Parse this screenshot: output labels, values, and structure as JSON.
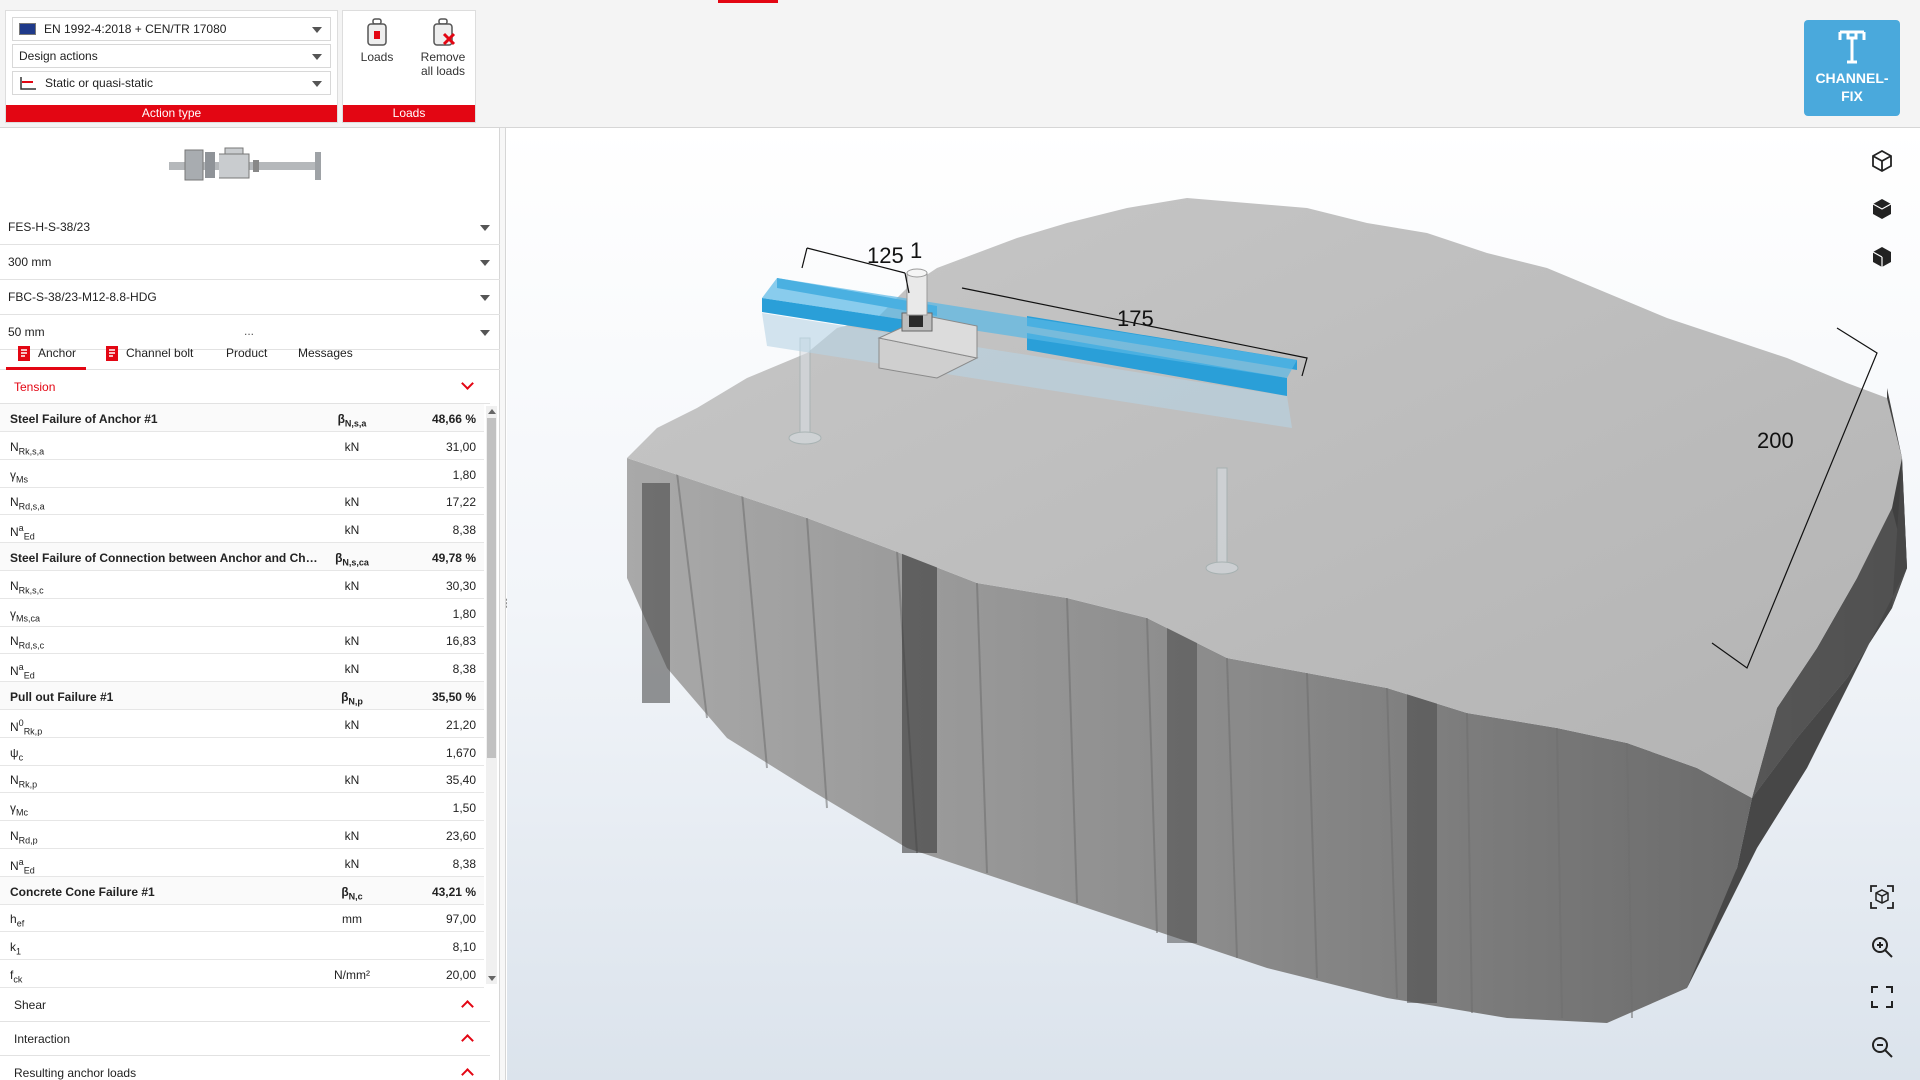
{
  "ribbon": {
    "action_type": {
      "standard": "EN 1992-4:2018 + CEN/TR 17080",
      "actions": "Design actions",
      "loading_type": "Static or quasi-static",
      "caption": "Action type"
    },
    "loads": {
      "loads_label": "Loads",
      "remove_label_1": "Remove",
      "remove_label_2": "all loads",
      "caption": "Loads"
    },
    "channelfix": {
      "line1": "CHANNEL-",
      "line2": "FIX"
    }
  },
  "product": {
    "channel": "FES-H-S-38/23",
    "length": "300 mm",
    "bolt": "FBC-S-38/23-M12-8.8-HDG",
    "edge": "50 mm",
    "dots": "..."
  },
  "tabs": [
    {
      "label": "Anchor"
    },
    {
      "label": "Channel bolt"
    },
    {
      "label": "Product"
    },
    {
      "label": "Messages"
    }
  ],
  "sections": {
    "tension": "Tension",
    "shear": "Shear",
    "interaction": "Interaction",
    "resulting": "Resulting anchor loads"
  },
  "results": [
    {
      "kind": "head",
      "name": "Steel Failure of Anchor #1",
      "sym": "β",
      "sub": "N,s,a",
      "value": "48,66 %"
    },
    {
      "kind": "row",
      "sym": "N",
      "sub": "Rk,s,a",
      "unit": "kN",
      "value": "31,00"
    },
    {
      "kind": "row",
      "sym": "γ",
      "sub": "Ms",
      "unit": "",
      "value": "1,80"
    },
    {
      "kind": "row",
      "sym": "N",
      "sub": "Rd,s,a",
      "unit": "kN",
      "value": "17,22"
    },
    {
      "kind": "row",
      "sym": "N",
      "sup": "a",
      "sub": "Ed",
      "unit": "kN",
      "value": "8,38"
    },
    {
      "kind": "head",
      "name": "Steel Failure of Connection between Anchor and Channel",
      "sym": "β",
      "sub": "N,s,ca",
      "value": "49,78 %"
    },
    {
      "kind": "row",
      "sym": "N",
      "sub": "Rk,s,c",
      "unit": "kN",
      "value": "30,30"
    },
    {
      "kind": "row",
      "sym": "γ",
      "sub": "Ms,ca",
      "unit": "",
      "value": "1,80"
    },
    {
      "kind": "row",
      "sym": "N",
      "sub": "Rd,s,c",
      "unit": "kN",
      "value": "16,83"
    },
    {
      "kind": "row",
      "sym": "N",
      "sup": "a",
      "sub": "Ed",
      "unit": "kN",
      "value": "8,38"
    },
    {
      "kind": "head",
      "name": "Pull out Failure #1",
      "sym": "β",
      "sub": "N,p",
      "value": "35,50 %"
    },
    {
      "kind": "row",
      "sym": "N",
      "sup": "0",
      "sub": "Rk,p",
      "unit": "kN",
      "value": "21,20"
    },
    {
      "kind": "row",
      "sym": "ψ",
      "sub": "c",
      "unit": "",
      "value": "1,670"
    },
    {
      "kind": "row",
      "sym": "N",
      "sub": "Rk,p",
      "unit": "kN",
      "value": "35,40"
    },
    {
      "kind": "row",
      "sym": "γ",
      "sub": "Mc",
      "unit": "",
      "value": "1,50"
    },
    {
      "kind": "row",
      "sym": "N",
      "sub": "Rd,p",
      "unit": "kN",
      "value": "23,60"
    },
    {
      "kind": "row",
      "sym": "N",
      "sup": "a",
      "sub": "Ed",
      "unit": "kN",
      "value": "8,38"
    },
    {
      "kind": "head",
      "name": "Concrete Cone Failure #1",
      "sym": "β",
      "sub": "N,c",
      "value": "43,21 %"
    },
    {
      "kind": "row",
      "sym": "h",
      "sub": "ef",
      "unit": "mm",
      "value": "97,00"
    },
    {
      "kind": "row",
      "sym": "k",
      "sub": "1",
      "unit": "",
      "value": "8,10"
    },
    {
      "kind": "row",
      "sym": "f",
      "sub": "ck",
      "unit": "N/mm²",
      "value": "20,00"
    }
  ],
  "viewport": {
    "dims": {
      "d125": "125",
      "d1": "1",
      "d175": "175",
      "d200": "200"
    }
  },
  "colors": {
    "accent": "#e30613",
    "channel": "#2a9fd8",
    "brand": "#4aa9dc"
  }
}
